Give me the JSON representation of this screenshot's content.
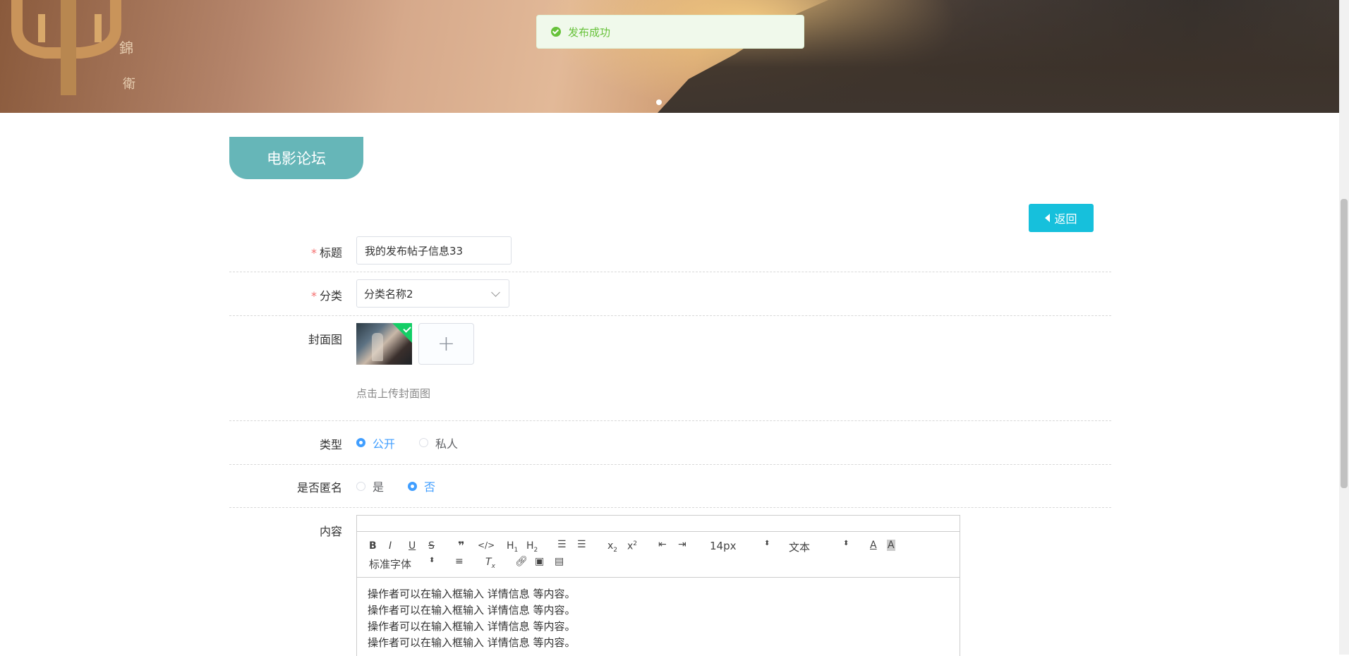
{
  "toast": {
    "message": "发布成功",
    "icon": "success-check-icon",
    "color": "#67c23a"
  },
  "banner": {
    "logo_text": ""
  },
  "forum_tab": {
    "label": "电影论坛",
    "color": "#66b6b8"
  },
  "back_button": {
    "label": "返回",
    "color": "#16c0dc"
  },
  "form": {
    "title": {
      "label": "标题",
      "required": true,
      "value": "我的发布帖子信息33"
    },
    "category": {
      "label": "分类",
      "required": true,
      "value": "分类名称2"
    },
    "cover": {
      "label": "封面图",
      "tip": "点击上传封面图"
    },
    "type": {
      "label": "类型",
      "options": [
        "公开",
        "私人"
      ],
      "selected": "公开"
    },
    "anonymous": {
      "label": "是否匿名",
      "options": [
        "是",
        "否"
      ],
      "selected": "否"
    },
    "content": {
      "label": "内容",
      "toolbar": {
        "font_size": "14px",
        "heading": "文本",
        "font_family": "标准字体",
        "buttons": [
          "bold",
          "italic",
          "underline",
          "strike",
          "blockquote",
          "code-block",
          "h1",
          "h2",
          "ordered-list",
          "bullet-list",
          "subscript",
          "superscript",
          "outdent",
          "indent",
          "text-color",
          "background-color",
          "align",
          "clean",
          "link",
          "image",
          "video"
        ]
      },
      "lines": [
        "操作者可以在输入框输入  详情信息  等内容。",
        "操作者可以在输入框输入  详情信息  等内容。",
        "操作者可以在输入框输入  详情信息  等内容。",
        "操作者可以在输入框输入  详情信息  等内容。"
      ]
    }
  },
  "required_mark": "*"
}
